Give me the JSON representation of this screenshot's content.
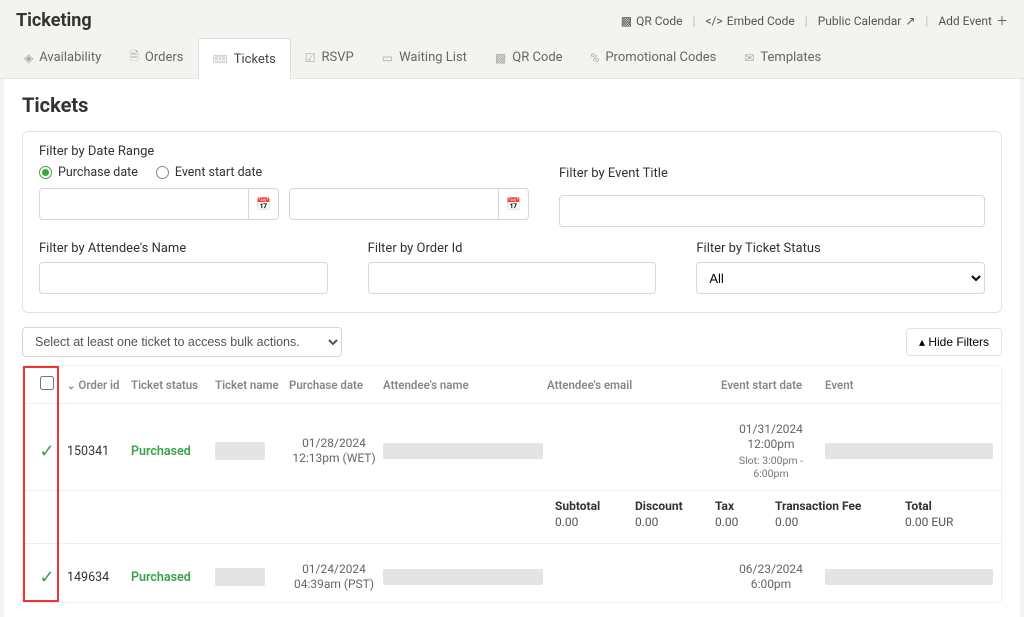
{
  "header": {
    "title": "Ticketing",
    "actions": {
      "qr_code": "QR Code",
      "embed_code": "Embed Code",
      "public_calendar": "Public Calendar",
      "add_event": "Add Event"
    }
  },
  "tabs": [
    {
      "label": "Availability",
      "icon": "◈"
    },
    {
      "label": "Orders",
      "icon": "🗎"
    },
    {
      "label": "Tickets",
      "icon": "🎟",
      "active": true
    },
    {
      "label": "RSVP",
      "icon": "☑"
    },
    {
      "label": "Waiting List",
      "icon": "▭"
    },
    {
      "label": "QR Code",
      "icon": "▩"
    },
    {
      "label": "Promotional Codes",
      "icon": "%"
    },
    {
      "label": "Templates",
      "icon": "✉"
    }
  ],
  "panel": {
    "title": "Tickets"
  },
  "filters": {
    "date_range_label": "Filter by Date Range",
    "radio_purchase": "Purchase date",
    "radio_event_start": "Event start date",
    "radio_selected": "purchase",
    "event_title_label": "Filter by Event Title",
    "attendee_name_label": "Filter by Attendee's Name",
    "order_id_label": "Filter by Order Id",
    "ticket_status_label": "Filter by Ticket Status",
    "ticket_status_value": "All"
  },
  "controls": {
    "bulk_placeholder": "Select at least one ticket to access bulk actions.",
    "hide_filters": "Hide Filters"
  },
  "table": {
    "columns": {
      "order_id": "Order id",
      "ticket_status": "Ticket status",
      "ticket_name": "Ticket name",
      "purchase_date": "Purchase date",
      "attendee_name": "Attendee's name",
      "attendee_email": "Attendee's email",
      "event_start": "Event start date",
      "event": "Event"
    },
    "rows": [
      {
        "order_id": "150341",
        "status": "Purchased",
        "purchase_date": "01/28/2024",
        "purchase_time": "12:13pm (WET)",
        "event_date": "01/31/2024",
        "event_time": "12:00pm",
        "slot": "Slot: 3:00pm - 6:00pm"
      },
      {
        "order_id": "149634",
        "status": "Purchased",
        "purchase_date": "01/24/2024",
        "purchase_time": "04:39am (PST)",
        "event_date": "06/23/2024",
        "event_time": "6:00pm",
        "slot": ""
      }
    ]
  },
  "totals": {
    "subtotal_label": "Subtotal",
    "subtotal_value": "0.00",
    "discount_label": "Discount",
    "discount_value": "0.00",
    "tax_label": "Tax",
    "tax_value": "0.00",
    "fee_label": "Transaction Fee",
    "fee_value": "0.00",
    "total_label": "Total",
    "total_value": "0.00 EUR"
  }
}
